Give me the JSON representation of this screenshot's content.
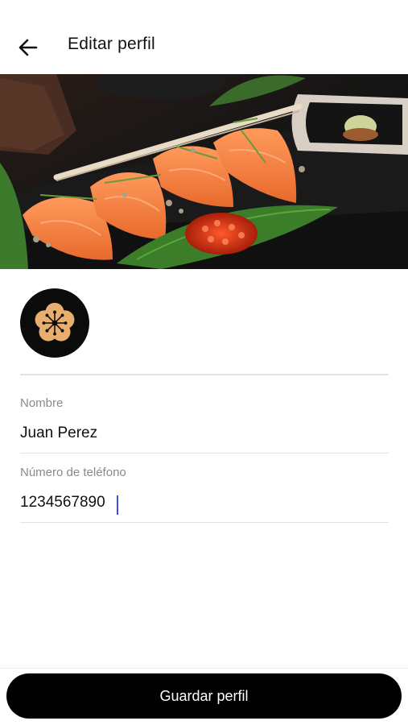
{
  "header": {
    "title": "Editar perfil",
    "back_icon": "arrow-left-icon"
  },
  "banner": {
    "image_icon": "sushi-photo"
  },
  "avatar": {
    "icon": "plum-blossom-icon",
    "accent_color": "#e8ae6e",
    "background_color": "#0b0b0b"
  },
  "form": {
    "name": {
      "label": "Nombre",
      "value": "Juan Perez"
    },
    "phone": {
      "label": "Número de teléfono",
      "value": "1234567890"
    }
  },
  "footer": {
    "save_label": "Guardar perfil"
  },
  "colors": {
    "caret": "#3b4fd8",
    "button": "#000000"
  }
}
